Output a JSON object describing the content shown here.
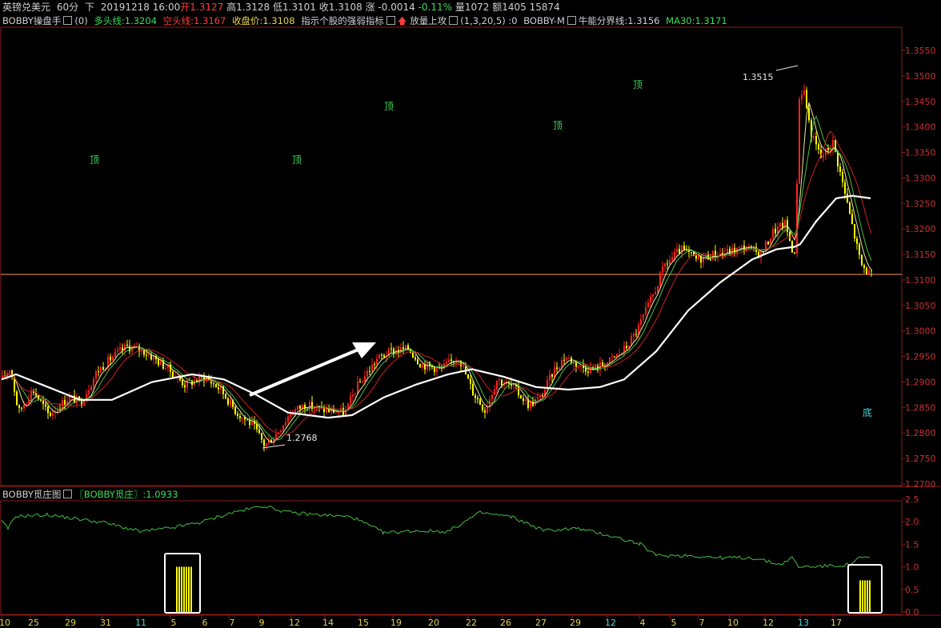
{
  "header": {
    "name": "英镑兑美元",
    "period": "60分",
    "dir": "下",
    "datetime": "20191218 16:00",
    "open": "开1.3127",
    "high": "高1.3128",
    "low": "低1.3101",
    "close": "收1.3108",
    "change": "涨 -0.0014",
    "change_pct": "-0.11%",
    "volume": "量1072",
    "amount": "额1405",
    "extra": "15874"
  },
  "indicator_main": {
    "name": "BOBBY操盘手",
    "param": "(0)",
    "long_line": "多头线:1.3204",
    "short_line": "空头线:1.3167",
    "close_price": "收盘价:1.3108",
    "strength": "指示个股的强弱指标",
    "volume_attack": "放量上攻",
    "volume_param": "(1,3,20,5)",
    "zero": ":0",
    "bobby_m": "BOBBY-M",
    "bull_line": "牛能分界线:1.3156",
    "ma30": "MA30:1.3171"
  },
  "indicator_sub": {
    "name": "BOBBY觅庄图",
    "label": "〖BOBBY觅庄〗",
    "value": ":1.0933"
  },
  "price_axis": [
    "1.3550",
    "1.3500",
    "1.3450",
    "1.3400",
    "1.3350",
    "1.3300",
    "1.3250",
    "1.3200",
    "1.3150",
    "1.3100",
    "1.3050",
    "1.3000",
    "1.2950",
    "1.2900",
    "1.2850",
    "1.2800",
    "1.2750",
    "1.2700"
  ],
  "sub_axis": [
    "2.5",
    "2.0",
    "1.5",
    "1.0",
    "0.5",
    "0.0"
  ],
  "date_axis": [
    "10",
    "25",
    "29",
    "31",
    "11",
    "5",
    "6",
    "7",
    "9",
    "12",
    "14",
    "15",
    "19",
    "20",
    "22",
    "26",
    "27",
    "29",
    "12",
    "4",
    "5",
    "7",
    "10",
    "12",
    "13",
    "17"
  ],
  "annotations": {
    "tops": [
      "顶",
      "顶",
      "顶",
      "顶",
      "顶"
    ],
    "bottom": "底",
    "high_label": "1.3515",
    "low_label": "1.2768"
  },
  "colors": {
    "background": "#000000",
    "up": "#ff2020",
    "down": "#ffff00",
    "ma_white": "#ffffff",
    "ma_red": "#d02020",
    "ma_green": "#40c040",
    "sub_line": "#40c040",
    "border": "#8b1a1a",
    "hline": "#ff9966"
  }
}
